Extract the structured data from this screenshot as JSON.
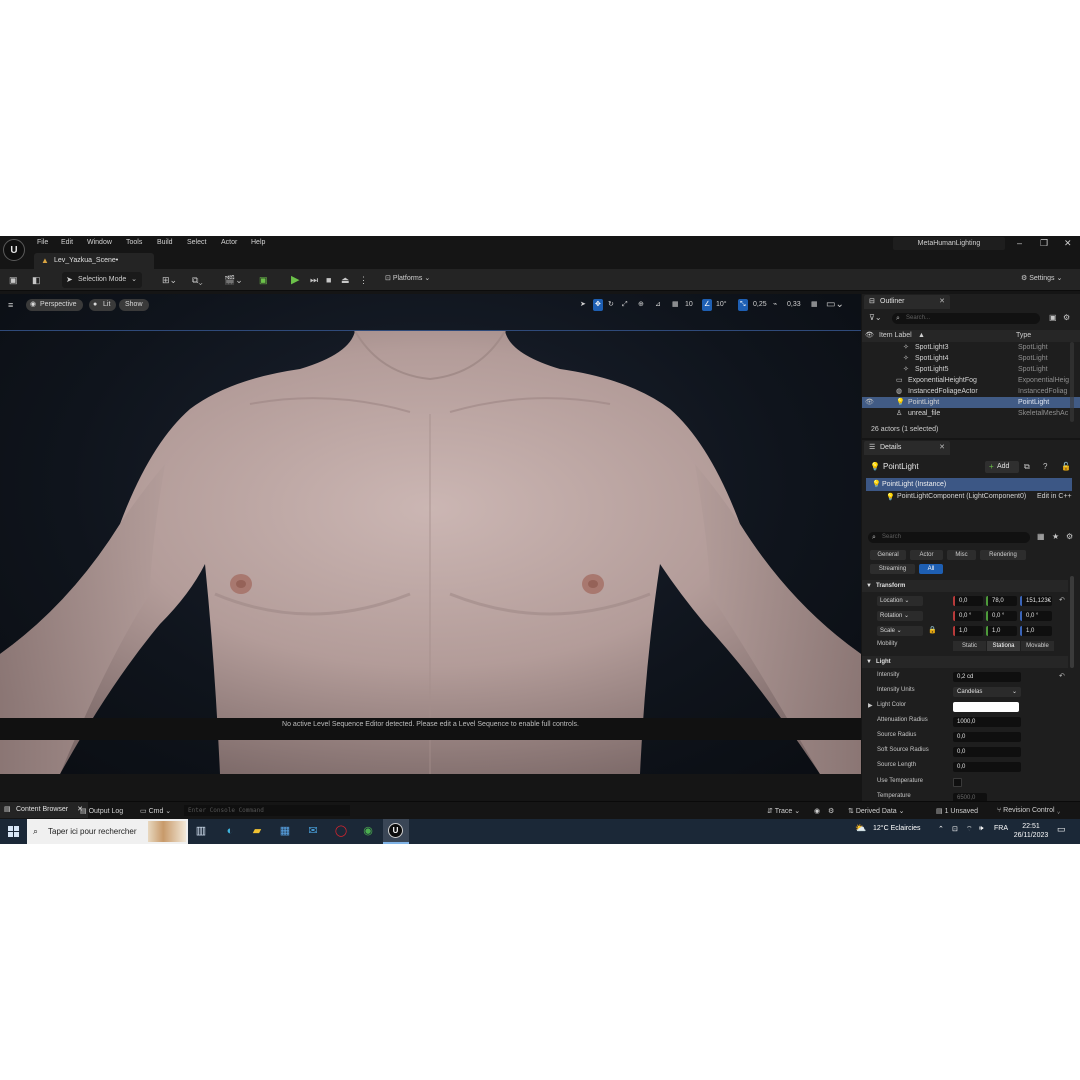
{
  "menu": [
    "File",
    "Edit",
    "Window",
    "Tools",
    "Build",
    "Select",
    "Actor",
    "Help"
  ],
  "project_name": "MetaHumanLighting",
  "window_controls": {
    "minimize": "–",
    "maximize": "❐",
    "close": "✕"
  },
  "level_tab": "Lev_Yazkua_Scene•",
  "toolbar": {
    "selection_mode": "Selection Mode",
    "platforms": "Platforms",
    "settings": "Settings"
  },
  "viewport": {
    "perspective": "Perspective",
    "lit": "Lit",
    "show": "Show",
    "grid_snap": "10",
    "rotation_snap": "10°",
    "scale_snap": "0,25",
    "camera_speed": "0,33",
    "sequence_message": "No active Level Sequence Editor detected. Please edit a Level Sequence to enable full controls."
  },
  "outliner": {
    "tab": "Outliner",
    "search_placeholder": "Search...",
    "col_label": "Item Label",
    "col_type": "Type",
    "rows": [
      {
        "label": "SpotLight3",
        "type": "SpotLight",
        "selected": false
      },
      {
        "label": "SpotLight4",
        "type": "SpotLight",
        "selected": false
      },
      {
        "label": "SpotLight5",
        "type": "SpotLight",
        "selected": false
      },
      {
        "label": "ExponentialHeightFog",
        "type": "ExponentialHeig",
        "selected": false
      },
      {
        "label": "InstancedFoliageActor",
        "type": "InstancedFoliag",
        "selected": false
      },
      {
        "label": "PointLight",
        "type": "PointLight",
        "selected": true
      },
      {
        "label": "unreal_file",
        "type": "SkeletalMeshAc",
        "selected": false
      }
    ],
    "actor_count": "26 actors (1 selected)"
  },
  "details": {
    "tab": "Details",
    "title": "PointLight",
    "add_label": "Add",
    "instance": "PointLight (Instance)",
    "component": "PointLightComponent (LightComponent0)",
    "edit_cpp": "Edit in C++",
    "search_placeholder": "Search",
    "filters": [
      "General",
      "Actor",
      "Misc",
      "Rendering",
      "Streaming",
      "All"
    ],
    "active_filter": "All",
    "transform_header": "Transform",
    "location_label": "Location",
    "location": [
      "0,0",
      "78,0",
      "151,123€"
    ],
    "rotation_label": "Rotation",
    "rotation": [
      "0,0 °",
      "0,0 °",
      "0,0 °"
    ],
    "scale_label": "Scale",
    "scale": [
      "1,0",
      "1,0",
      "1,0"
    ],
    "mobility_label": "Mobility",
    "mobility_options": [
      "Static",
      "Stationa",
      "Movable"
    ],
    "mobility_selected": "Stationa",
    "light_header": "Light",
    "intensity_label": "Intensity",
    "intensity": "0,2 cd",
    "intensity_units_label": "Intensity Units",
    "intensity_units": "Candelas",
    "light_color_label": "Light Color",
    "light_color": "#ffffff",
    "attenuation_radius_label": "Attenuation Radius",
    "attenuation_radius": "1000,0",
    "source_radius_label": "Source Radius",
    "source_radius": "0,0",
    "soft_source_radius_label": "Soft Source Radius",
    "soft_source_radius": "0,0",
    "source_length_label": "Source Length",
    "source_length": "0,0",
    "use_temperature_label": "Use Temperature",
    "temperature_label": "Temperature",
    "temperature": "6500,0"
  },
  "statusbar": {
    "content_browser": "Content Browser",
    "output_log": "Output Log",
    "cmd": "Cmd",
    "console_placeholder": "Enter Console Command",
    "trace": "Trace",
    "derived_data": "Derived Data",
    "unsaved": "1 Unsaved",
    "revision_control": "Revision Control"
  },
  "taskbar": {
    "search_placeholder": "Taper ici pour rechercher",
    "weather": "12°C  Eclaircies",
    "language": "FRA",
    "time": "22:51",
    "date": "26/11/2023"
  }
}
